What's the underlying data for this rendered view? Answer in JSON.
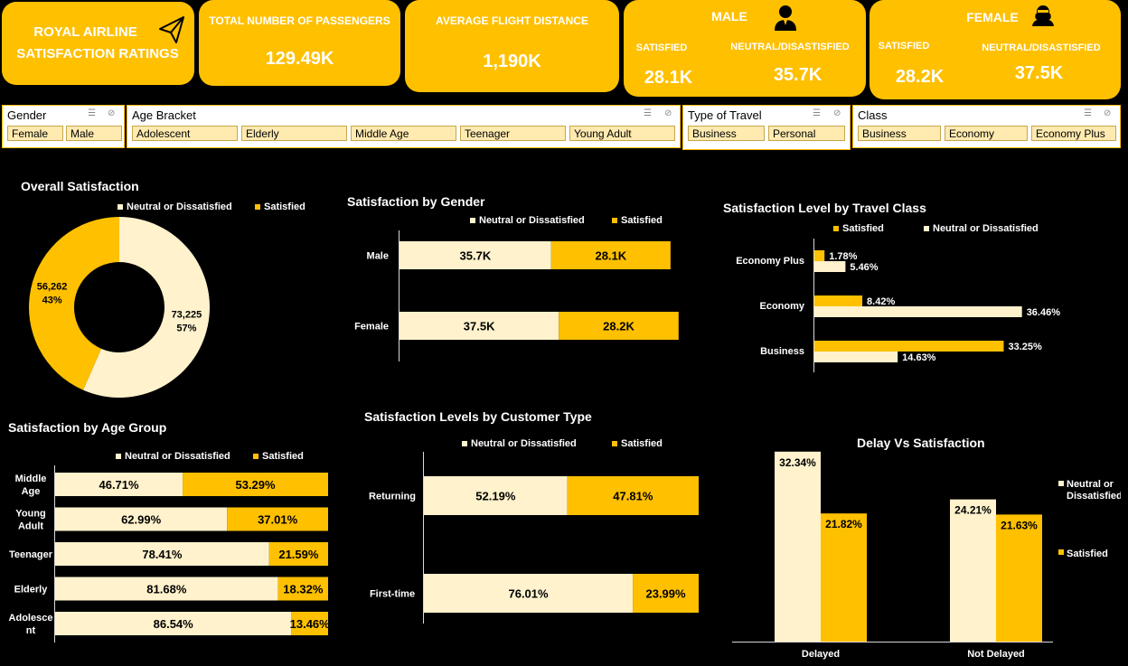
{
  "header": {
    "title_line1": "ROYAL AIRLINE",
    "title_line2": "SATISFACTION RATINGS",
    "plane_icon": "paper-plane-icon",
    "passengers": {
      "label": "TOTAL NUMBER OF PASSENGERS",
      "value": "129.49K"
    },
    "distance": {
      "label": "AVERAGE FLIGHT DISTANCE",
      "value": "1,190K"
    },
    "male": {
      "label": "MALE",
      "satisfied_label": "SATISFIED",
      "neutral_label": "NEUTRAL/DISASTISFIED",
      "satisfied": "28.1K",
      "neutral": "35.7K",
      "icon": "male-user-icon"
    },
    "female": {
      "label": "FEMALE",
      "satisfied_label": "SATISFIED",
      "neutral_label": "NEUTRAL/DISASTISFIED",
      "satisfied": "28.2K",
      "neutral": "37.5K",
      "icon": "female-user-icon"
    }
  },
  "slicers": {
    "gender": {
      "title": "Gender",
      "options": [
        "Female",
        "Male"
      ]
    },
    "age": {
      "title": "Age Bracket",
      "options": [
        "Adolescent",
        "Elderly",
        "Middle Age",
        "Teenager",
        "Young Adult"
      ]
    },
    "travel": {
      "title": "Type of Travel",
      "options": [
        "Business",
        "Personal"
      ]
    },
    "class": {
      "title": "Class",
      "options": [
        "Business",
        "Economy",
        "Economy Plus"
      ]
    }
  },
  "legend": {
    "neutral": "Neutral or Dissatisfied",
    "satisfied": "Satisfied"
  },
  "colors": {
    "gold": "#FFC000",
    "cream": "#FFF2CC",
    "background": "#000000"
  },
  "chart_data": [
    {
      "type": "pie",
      "title": "Overall Satisfaction",
      "slices": [
        {
          "name": "Neutral or Dissatisfied",
          "value": 73225,
          "label": "73,225",
          "pct": "57%"
        },
        {
          "name": "Satisfied",
          "value": 56262,
          "label": "56,262",
          "pct": "43%"
        }
      ]
    },
    {
      "type": "bar",
      "title": "Satisfaction by Gender",
      "categories": [
        "Male",
        "Female"
      ],
      "series": [
        {
          "name": "Neutral or Dissatisfied",
          "values": [
            35.7,
            37.5
          ],
          "labels": [
            "35.7K",
            "37.5K"
          ]
        },
        {
          "name": "Satisfied",
          "values": [
            28.1,
            28.2
          ],
          "labels": [
            "28.1K",
            "28.2K"
          ]
        }
      ]
    },
    {
      "type": "bar",
      "title": "Satisfaction Level by Travel Class",
      "categories": [
        "Economy Plus",
        "Economy",
        "Business"
      ],
      "series": [
        {
          "name": "Satisfied",
          "values": [
            1.78,
            8.42,
            33.25
          ],
          "labels": [
            "1.78%",
            "8.42%",
            "33.25%"
          ]
        },
        {
          "name": "Neutral or Dissatisfied",
          "values": [
            5.46,
            36.46,
            14.63
          ],
          "labels": [
            "5.46%",
            "36.46%",
            "14.63%"
          ]
        }
      ]
    },
    {
      "type": "bar",
      "title": "Satisfaction by Age Group",
      "categories": [
        "Middle Age",
        "Young Adult",
        "Teenager",
        "Elderly",
        "Adolescent"
      ],
      "category_labels": [
        [
          "Middle",
          "Age"
        ],
        [
          "Young",
          "Adult"
        ],
        [
          "Teenager"
        ],
        [
          "Elderly"
        ],
        [
          "Adolesce",
          "nt"
        ]
      ],
      "series": [
        {
          "name": "Neutral or Dissatisfied",
          "values": [
            46.71,
            62.99,
            78.41,
            81.68,
            86.54
          ],
          "labels": [
            "46.71%",
            "62.99%",
            "78.41%",
            "81.68%",
            "86.54%"
          ]
        },
        {
          "name": "Satisfied",
          "values": [
            53.29,
            37.01,
            21.59,
            18.32,
            13.46
          ],
          "labels": [
            "53.29%",
            "37.01%",
            "21.59%",
            "18.32%",
            "13.46%"
          ]
        }
      ]
    },
    {
      "type": "bar",
      "title": "Satisfaction Levels by Customer Type",
      "categories": [
        "Returning",
        "First-time"
      ],
      "series": [
        {
          "name": "Neutral or Dissatisfied",
          "values": [
            52.19,
            76.01
          ],
          "labels": [
            "52.19%",
            "76.01%"
          ]
        },
        {
          "name": "Satisfied",
          "values": [
            47.81,
            23.99
          ],
          "labels": [
            "47.81%",
            "23.99%"
          ]
        }
      ]
    },
    {
      "type": "bar",
      "title": "Delay Vs Satisfaction",
      "categories": [
        "Delayed",
        "Not Delayed"
      ],
      "legend_neutral": [
        "Neutral or",
        "Dissatisfied"
      ],
      "series": [
        {
          "name": "Neutral or Dissatisfied",
          "values": [
            32.34,
            24.21
          ],
          "labels": [
            "32.34%",
            "24.21%"
          ]
        },
        {
          "name": "Satisfied",
          "values": [
            21.82,
            21.63
          ],
          "labels": [
            "21.82%",
            "21.63%"
          ]
        }
      ]
    }
  ]
}
